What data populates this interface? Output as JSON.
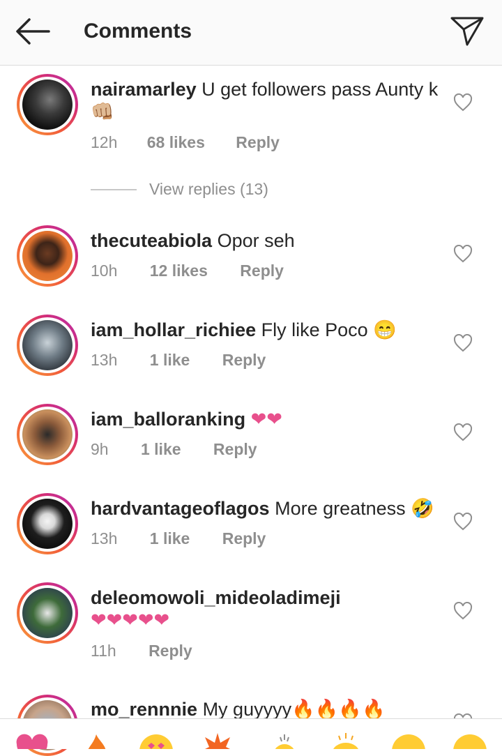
{
  "header": {
    "title": "Comments",
    "back_icon": "back-arrow-icon",
    "send_icon": "direct-send-icon"
  },
  "comments": [
    {
      "username": "nairamarley",
      "text": "U get followers pass Aunty k👊🏼",
      "time": "12h",
      "likes": "68 likes",
      "reply": "Reply"
    },
    {
      "username": "thecuteabiola",
      "text": "Opor seh",
      "time": "10h",
      "likes": "12 likes",
      "reply": "Reply"
    },
    {
      "username": "iam_hollar_richiee",
      "text": "Fly like Poco 😁",
      "time": "13h",
      "likes": "1 like",
      "reply": "Reply"
    },
    {
      "username": "iam_balloranking",
      "text": "❤❤",
      "time": "9h",
      "likes": "1 like",
      "reply": "Reply"
    },
    {
      "username": "hardvantageoflagos",
      "text": "More greatness 🤣",
      "time": "13h",
      "likes": "1 like",
      "reply": "Reply"
    },
    {
      "username": "deleomowoli_mideoladimeji",
      "text": "❤❤❤❤❤",
      "time": "11h",
      "likes": "",
      "reply": "Reply"
    },
    {
      "username": "mo_rennnie",
      "text": "My guyyyy🔥🔥🔥🔥",
      "time": "",
      "likes": "",
      "reply": ""
    }
  ],
  "view_replies": "View replies (13)",
  "emoji_bar": [
    "❤",
    "🔥",
    "😍",
    "💥",
    "👏",
    "👏",
    "😊",
    "😂"
  ],
  "colors": {
    "accent_heart": "#e8508c",
    "muted_text": "#8e8e8e",
    "ring_start": "#f9a23c",
    "ring_end": "#b42fb4"
  }
}
